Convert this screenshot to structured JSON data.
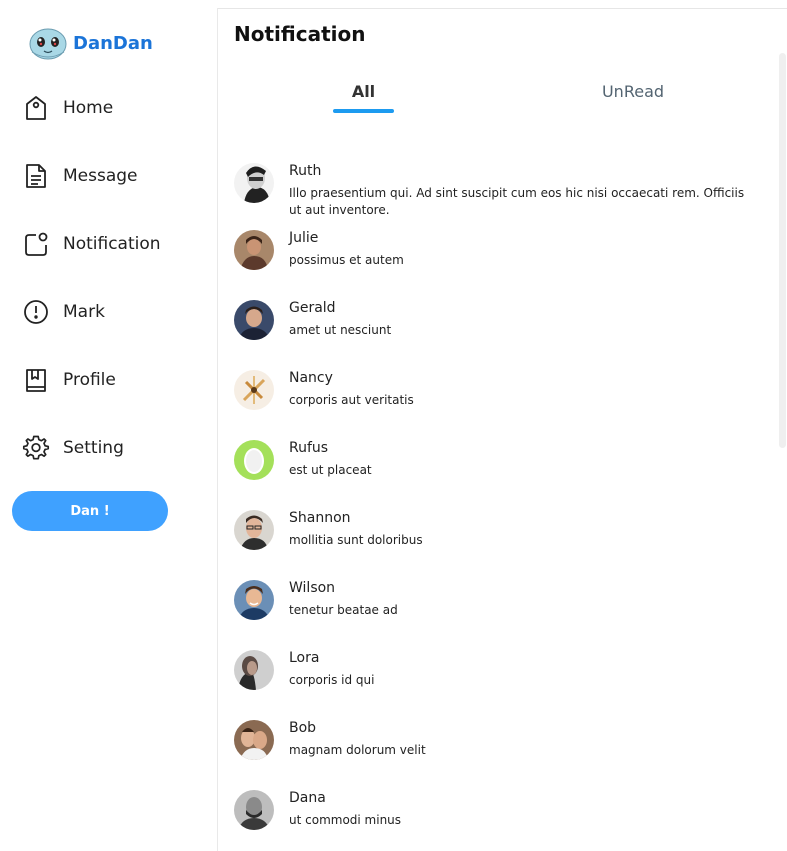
{
  "brand": {
    "name": "DanDan"
  },
  "sidebar": {
    "items": [
      {
        "label": "Home",
        "icon": "tag-icon"
      },
      {
        "label": "Message",
        "icon": "document-icon"
      },
      {
        "label": "Notification",
        "icon": "notification-icon"
      },
      {
        "label": "Mark",
        "icon": "alert-circle-icon"
      },
      {
        "label": "Profile",
        "icon": "bookmark-book-icon"
      },
      {
        "label": "Setting",
        "icon": "gear-icon"
      }
    ],
    "button_label": "Dan !"
  },
  "main": {
    "title": "Notification",
    "tabs": [
      {
        "label": "All",
        "active": true
      },
      {
        "label": "UnRead",
        "active": false
      }
    ],
    "accent_color": "#1d9bf0"
  },
  "notifications": [
    {
      "name": "Ruth",
      "text": "Illo praesentium qui. Ad sint suscipit cum eos hic nisi occaecati rem. Officiis ut aut inventore."
    },
    {
      "name": "Julie",
      "text": "possimus et autem"
    },
    {
      "name": "Gerald",
      "text": "amet ut nesciunt"
    },
    {
      "name": "Nancy",
      "text": "corporis aut veritatis"
    },
    {
      "name": "Rufus",
      "text": "est ut placeat"
    },
    {
      "name": "Shannon",
      "text": "mollitia sunt doloribus"
    },
    {
      "name": "Wilson",
      "text": "tenetur beatae ad"
    },
    {
      "name": "Lora",
      "text": "corporis id qui"
    },
    {
      "name": "Bob",
      "text": "magnam dolorum velit"
    },
    {
      "name": "Dana",
      "text": "ut commodi minus"
    }
  ]
}
